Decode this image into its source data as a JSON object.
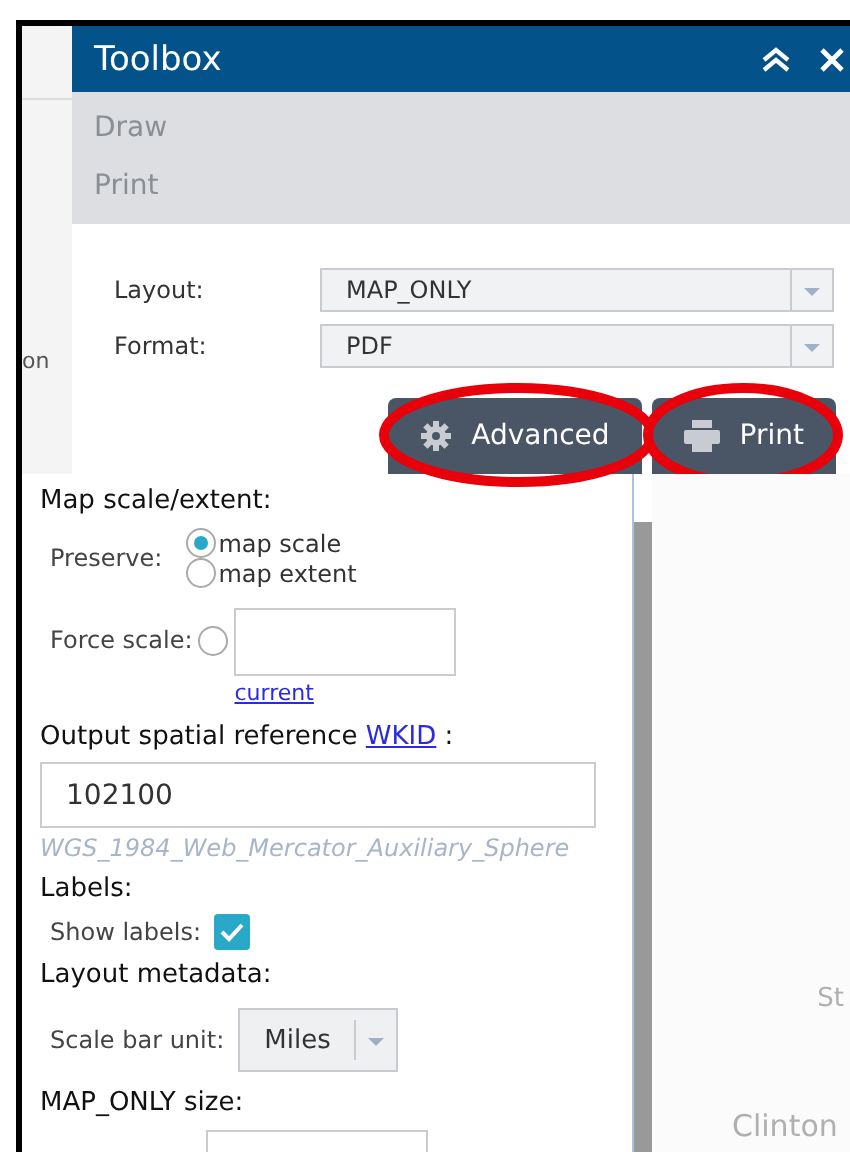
{
  "map_labels": [
    {
      "text": "on"
    },
    {
      "text": "St"
    },
    {
      "text": "Clinton"
    }
  ],
  "toolbox": {
    "title": "Toolbox",
    "tabs": [
      {
        "label": "Draw"
      },
      {
        "label": "Print"
      }
    ],
    "settings": [
      {
        "label": "Layout:",
        "value": "MAP_ONLY"
      },
      {
        "label": "Format:",
        "value": "PDF"
      }
    ],
    "buttons": [
      {
        "kind": "advanced",
        "label": "Advanced",
        "highlighted": true
      },
      {
        "kind": "print",
        "label": "Print",
        "highlighted": true
      }
    ]
  },
  "advanced": {
    "scale_heading": "Map scale/extent:",
    "preserve": {
      "label": "Preserve:",
      "options": [
        {
          "label": "map scale",
          "selected": true
        },
        {
          "label": "map extent",
          "selected": false
        }
      ]
    },
    "force_scale": {
      "label": "Force scale:",
      "selected": false,
      "link": "current"
    },
    "spatial_reference": {
      "label": "Output spatial reference",
      "link": "WKID",
      "suffix": ":",
      "value": "102100",
      "note": "WGS_1984_Web_Mercator_Auxiliary_Sphere"
    },
    "labels_heading": "Labels:",
    "show_labels": {
      "label": "Show labels:",
      "checked": true
    },
    "metadata_heading": "Layout metadata:",
    "scale_bar_unit": {
      "label": "Scale bar unit:",
      "value": "Miles"
    },
    "size_heading": "MAP_ONLY size:"
  }
}
